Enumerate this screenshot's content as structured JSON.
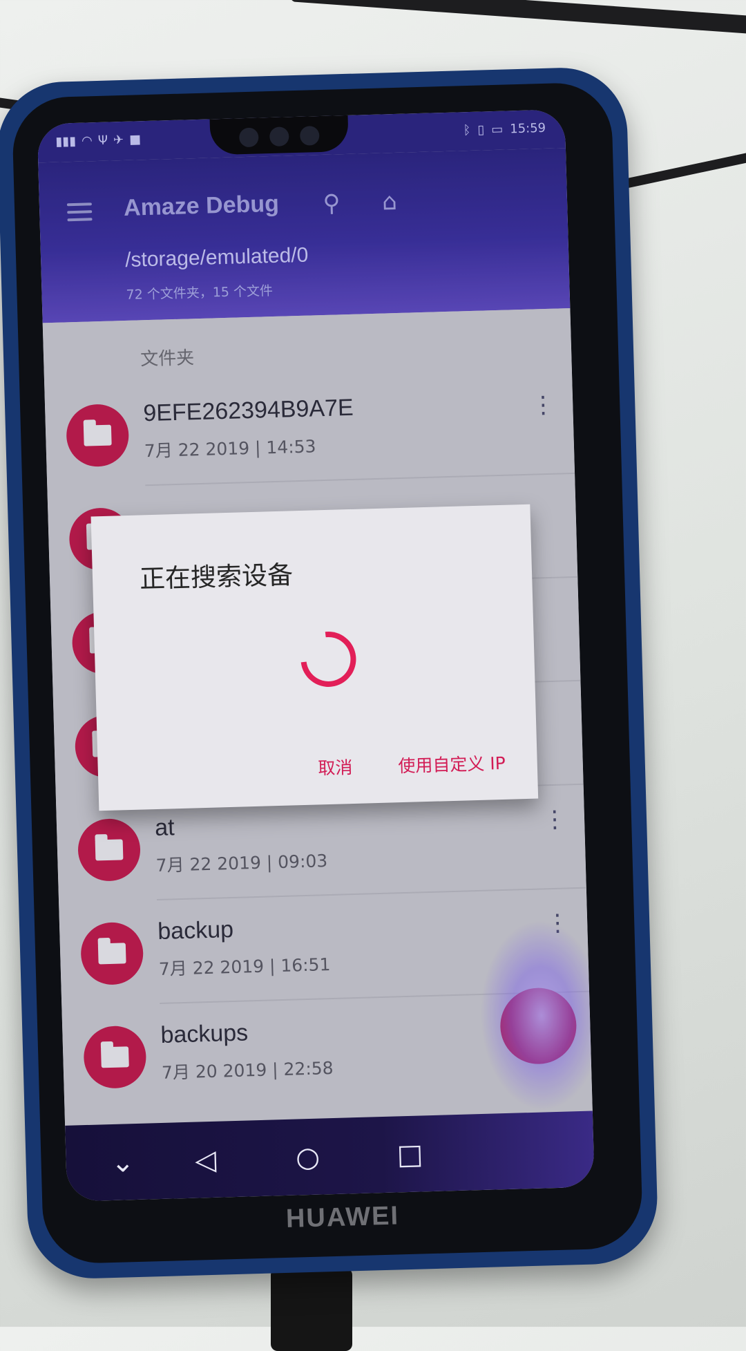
{
  "app": {
    "title": "Amaze Debug",
    "path": "/storage/emulated/0",
    "counts": "72 个文件夹，15 个文件"
  },
  "statusbar": {
    "time": "15:59",
    "left_icons": [
      "signal-icon",
      "wifi-icon",
      "usb-icon",
      "notification-icon",
      "app-icon"
    ],
    "right_icons": [
      "bluetooth-icon",
      "vibrate-icon",
      "battery-icon"
    ]
  },
  "toolbar": {
    "search_icon": "search-icon",
    "home_icon": "home-icon",
    "menu_icon": "menu-icon"
  },
  "list": {
    "section_label": "文件夹",
    "items": [
      {
        "name": "9EFE262394B9A7E",
        "date": "7月 22 2019 | 14:53"
      },
      {
        "name": "at",
        "date": "7月 22 2019 | 09:03"
      },
      {
        "name": "backup",
        "date": "7月 22 2019 | 16:51"
      },
      {
        "name": "backups",
        "date": "7月 20 2019 | 22:58"
      }
    ]
  },
  "dialog": {
    "title": "正在搜索设备",
    "cancel_label": "取消",
    "custom_ip_label": "使用自定义 IP"
  },
  "navbar": {
    "items": [
      "collapse-icon",
      "back-icon",
      "home-circle-icon",
      "recents-icon"
    ]
  },
  "device": {
    "brand": "HUAWEI"
  },
  "colors": {
    "accent": "#d21c55",
    "toolbar": "#2b2486",
    "folder": "#c5184d"
  }
}
